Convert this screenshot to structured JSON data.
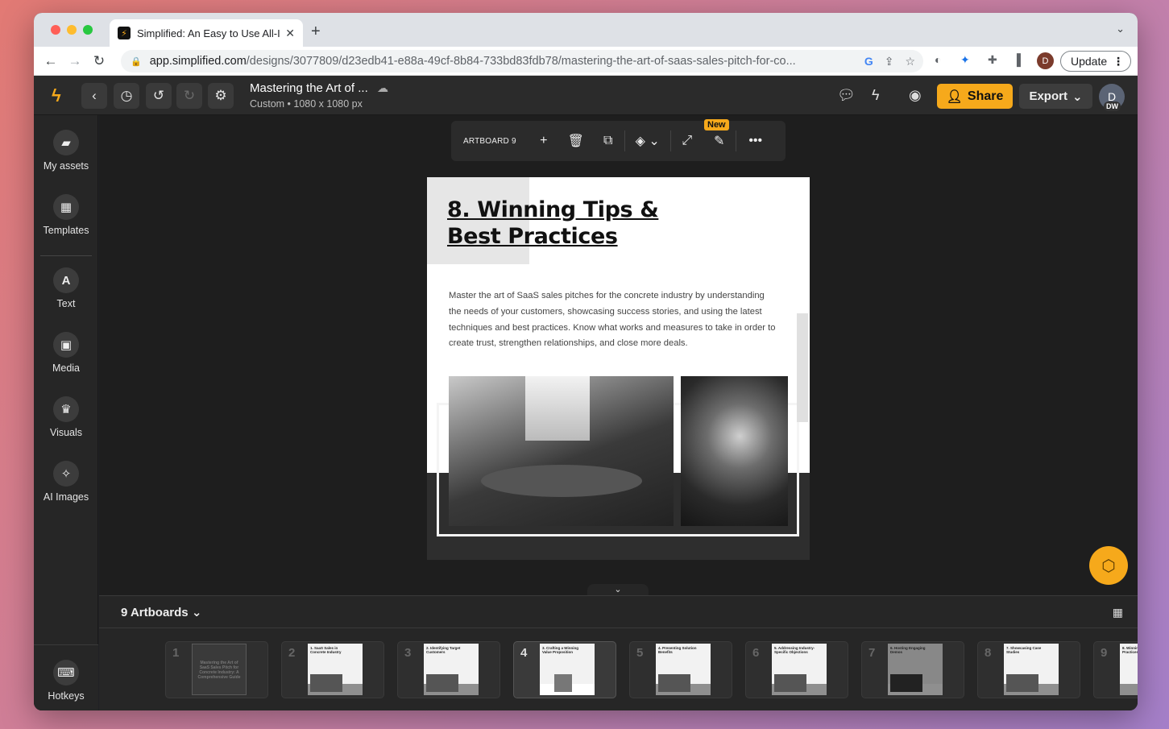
{
  "browser": {
    "tab_title": "Simplified: An Easy to Use All-I",
    "tab_close": "✕",
    "new_tab": "+",
    "url_host": "app.simplified.com",
    "url_path": "/designs/3077809/d23edb41-e88a-49cf-8b84-733bd83fdb78/mastering-the-art-of-saas-sales-pitch-for-co...",
    "profile_initial": "D",
    "update_label": "Update"
  },
  "header": {
    "doc_title": "Mastering the Art of ...",
    "doc_subtitle": "Custom • 1080 x 1080 px",
    "share_label": "Share",
    "export_label": "Export",
    "avatar_initial": "D",
    "avatar_badge": "DW"
  },
  "sidebar": {
    "items": [
      {
        "label": "My assets",
        "icon": "folder-icon"
      },
      {
        "label": "Templates",
        "icon": "grid-icon"
      },
      {
        "label": "Text",
        "icon": "text-icon"
      },
      {
        "label": "Media",
        "icon": "image-icon"
      },
      {
        "label": "Visuals",
        "icon": "crown-icon"
      },
      {
        "label": "AI Images",
        "icon": "magic-wand-icon"
      }
    ],
    "hotkeys_label": "Hotkeys"
  },
  "toolbar": {
    "artboard_label": "ARTBOARD 9",
    "new_badge": "New"
  },
  "artboard": {
    "title_line1": "8. Winning Tips &",
    "title_line2": "Best Practices",
    "body": "Master the art of SaaS sales pitches for the concrete industry by understanding the needs of your customers, showcasing success stories, and using the latest techniques and best practices. Know what works and measures to take in order to create trust, strengthen relationships, and close more deals."
  },
  "strip": {
    "header": "9 Artboards",
    "thumbs": [
      {
        "num": "1",
        "title": "Mastering the Art of SaaS Sales Pitch for Concrete Industry: A Comprehensive Guide"
      },
      {
        "num": "2",
        "title": "1. SaaS Sales in Concrete Industry"
      },
      {
        "num": "3",
        "title": "2. Identifying Target Customers"
      },
      {
        "num": "4",
        "title": "3. Crafting a Winning Value Proposition"
      },
      {
        "num": "5",
        "title": "4. Presenting Solution Benefits"
      },
      {
        "num": "6",
        "title": "5. Addressing Industry-Specific Objections"
      },
      {
        "num": "7",
        "title": "6. Hosting Engaging Demos"
      },
      {
        "num": "8",
        "title": "7. Showcasing Case Studies"
      },
      {
        "num": "9",
        "title": "8. Winning Tips & Best Practices"
      }
    ]
  },
  "colors": {
    "accent": "#f6a91b",
    "app_bg": "#1e1e1e",
    "panel_bg": "#262626"
  }
}
